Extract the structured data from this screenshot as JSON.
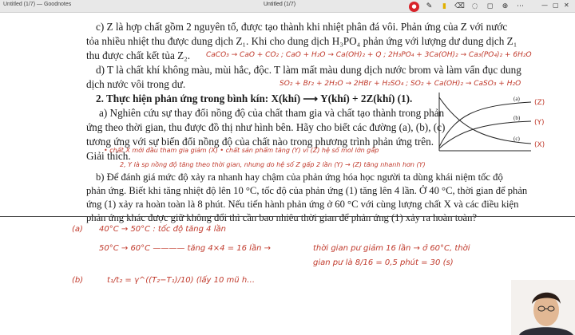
{
  "window": {
    "app_label": "Untitled (1/7) — Goodnotes",
    "doc_title": "Untitled (1/7)",
    "controls": [
      "—",
      "▢",
      "✕"
    ]
  },
  "toolbar": {
    "record": "●",
    "pen": "✎",
    "highlighter": "▮",
    "eraser": "⌫",
    "lasso": "◌",
    "shapes": "◻",
    "more": "⋯",
    "zoom": "⊕"
  },
  "lines": [
    "c) Z là hợp chất gồm 2 nguyên tố, được tạo thành khi nhiệt phân đá vôi. Phản ứng của Z với nước",
    "tỏa nhiều nhiệt thu được dung dịch Z₁. Khi cho dung dịch H₃PO₄ phản ứng với lượng dư dung dịch Z₁",
    "thu được chất kết tủa Z₂.",
    "d) T là chất khí không màu, mùi hắc, độc. T làm mất màu dung dịch nước brom và làm vẩn đục dung",
    "dịch nước vôi trong dư.",
    "2. Thực hiện phản ứng trong bình kín: X(khí) ⟶ Y(khí) + 2Z(khí) (1).",
    "a) Nghiên cứu sự thay đổi nồng độ của chất tham gia và chất tạo thành trong phản",
    "ứng theo thời gian, thu được đồ thị như hình bên. Hãy cho biết các đường (a), (b), (c)",
    "tương ứng với sự biến đổi nồng độ của chất nào trong phương trình phản ứng trên.",
    "Giải thích.",
    "b) Để đánh giá mức độ xảy ra nhanh hay chậm của phản ứng hóa học người ta dùng khái niệm tốc độ",
    "phản ứng. Biết khi tăng nhiệt độ lên 10 °C, tốc độ của phản ứng (1) tăng lên 4 lần. Ở 40 °C, thời gian để phản",
    "ứng (1) xảy ra hoàn toàn là 8 phút. Nếu tiến hành phản ứng ở 60 °C với cùng lượng chất X và các điều kiện",
    "phản ứng khác được giữ không đổi thì cần bao nhiêu thời gian để phản ứng (1) xảy ra hoàn toàn?"
  ],
  "handwriting": {
    "h1": "CaCO₃ → CaO + CO₂ ; CaO + H₂O → Ca(OH)₂ + Q ; 2H₃PO₄ + 3Ca(OH)₂ → Ca₃(PO₄)₂ + 6H₂O",
    "h2": "SO₂ + Br₂ + 2H₂O → 2HBr + H₂SO₄ ; SO₂ + Ca(OH)₂ → CaSO₃ + H₂O",
    "h3": "• chất X mới đầu tham gia giảm (X) • chất sản phẩm tăng (Y) vì (Z) hệ số mol lớn gấp",
    "h4": "2, Y là sp nồng độ tăng theo thời gian, nhưng do hệ số Z gấp 2 lần (Y) → (Z) tăng nhanh hơn (Y)",
    "label_a": "(a)",
    "label_b": "(b)",
    "r1_a": "40°C → 50°C : tốc độ tăng 4 lần",
    "r1_b": "50°C → 60°C ———— tăng 4×4 = 16 lần →",
    "r1_c": "thời gian pư giảm 16 lần → ở 60°C, thời",
    "r1_d": "gian pư là  8/16 = 0,5 phút = 30 (s)",
    "r2_a": "t₁/t₂ = γ^((T₂−T₁)/10)   (lấy 10 mũ h…"
  },
  "graph_labels": {
    "a": "(a)",
    "b": "(b)",
    "c": "(c)",
    "Z": "(Z)",
    "Y": "(Y)",
    "X": "(X)"
  }
}
